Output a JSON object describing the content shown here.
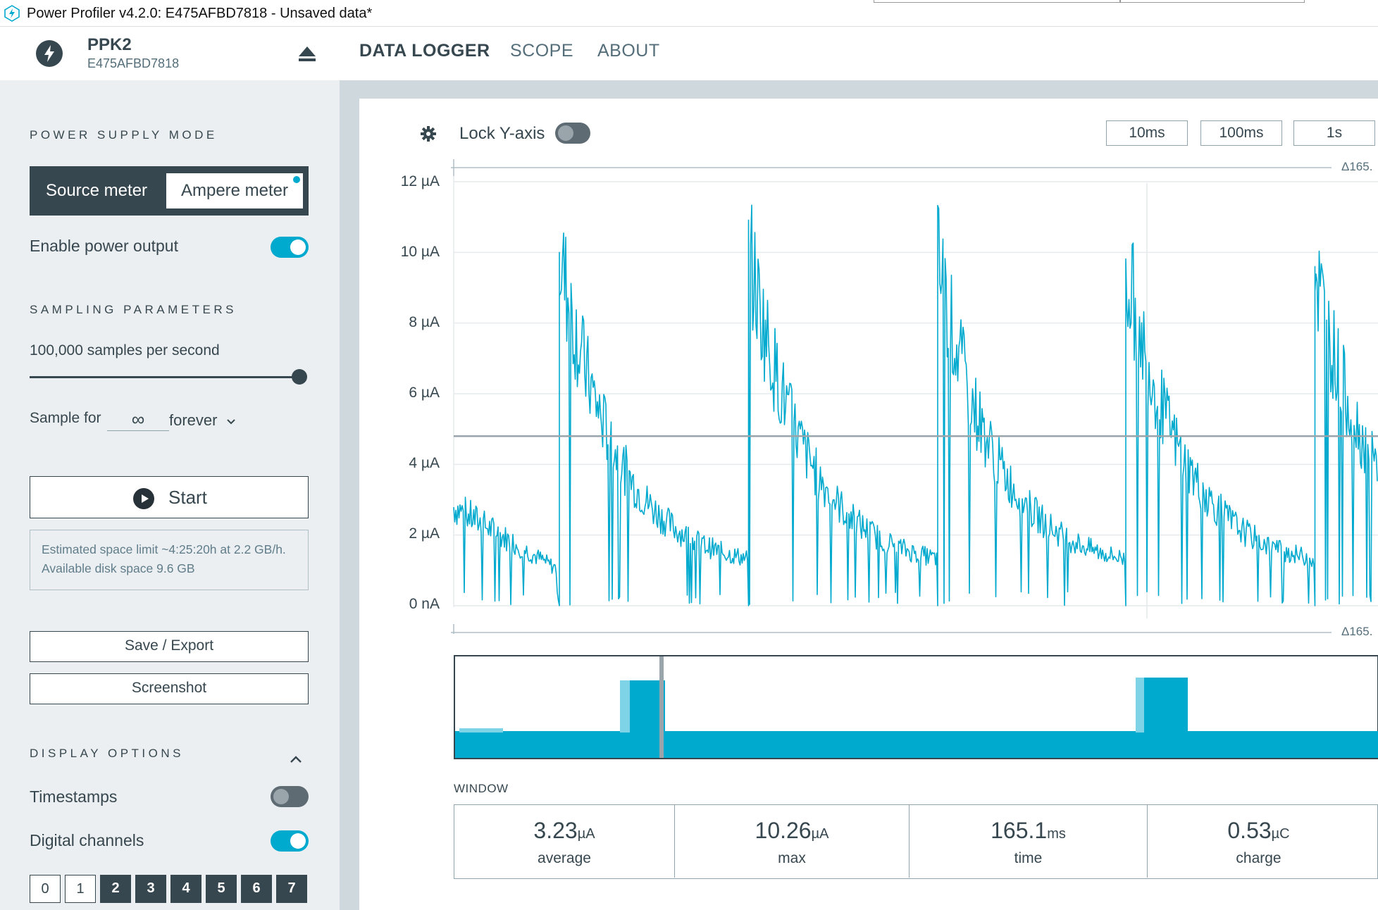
{
  "window": {
    "title": "Power Profiler v4.2.0: E475AFBD7818 - Unsaved data*"
  },
  "device": {
    "name": "PPK2",
    "serial": "E475AFBD7818"
  },
  "nav": {
    "tabs": [
      "DATA LOGGER",
      "SCOPE",
      "ABOUT"
    ],
    "active": "DATA LOGGER"
  },
  "sidebar": {
    "power_supply_title": "POWER SUPPLY MODE",
    "source_meter": "Source meter",
    "ampere_meter": "Ampere meter",
    "enable_power_output": "Enable power output",
    "enable_power_output_on": true,
    "sampling_title": "SAMPLING PARAMETERS",
    "samples_per_second": "100,000 samples per second",
    "sample_rate_fraction": 1.0,
    "sample_for_label": "Sample for",
    "sample_for_value": "∞",
    "sample_for_unit": "forever",
    "start_label": "Start",
    "space_info": "Estimated space limit ~4:25:20h at 2.2 GB/h. Available disk space 9.6 GB",
    "save_export": "Save / Export",
    "screenshot": "Screenshot",
    "display_title": "DISPLAY OPTIONS",
    "timestamps": "Timestamps",
    "timestamps_on": false,
    "digital_channels": "Digital channels",
    "digital_channels_on": true,
    "channels": [
      "0",
      "1",
      "2",
      "3",
      "4",
      "5",
      "6",
      "7"
    ],
    "channels_enabled": [
      false,
      false,
      true,
      true,
      true,
      true,
      true,
      true
    ]
  },
  "toolbar": {
    "lock_y_axis": "Lock Y-axis",
    "lock_y_axis_on": false,
    "time_buttons": [
      "10ms",
      "100ms",
      "1s"
    ]
  },
  "colors": {
    "trace": "#00a9ce",
    "dark": "#37474f",
    "sidebar_bg": "#eceff1",
    "main_bg": "#cfd8dc"
  },
  "chart_data": {
    "type": "line",
    "y_unit": "µA",
    "y_ticks": [
      "0 nA",
      "2 µA",
      "4 µA",
      "6 µA",
      "8 µA",
      "10 µA",
      "12 µA"
    ],
    "ylim": [
      0,
      12
    ],
    "delta_label": "Δ165.",
    "average_line": 4.8,
    "series": [
      {
        "pulse_peaks": [
          10.0,
          10.1,
          9.9,
          9.7,
          9.6
        ],
        "decay_floor": 1.0,
        "initial_level": 2.8
      }
    ]
  },
  "stats": {
    "window_label": "WINDOW",
    "items": [
      {
        "value": "3.23",
        "unit": "µA",
        "caption": "average"
      },
      {
        "value": "10.26",
        "unit": "µA",
        "caption": "max"
      },
      {
        "value": "165.1",
        "unit": "ms",
        "caption": "time"
      },
      {
        "value": "0.53",
        "unit": "µC",
        "caption": "charge"
      }
    ]
  }
}
